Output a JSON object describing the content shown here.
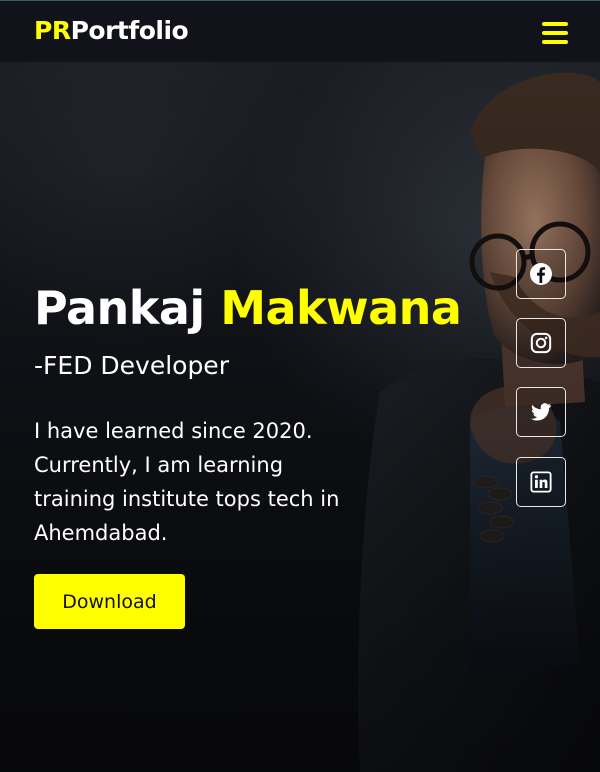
{
  "header": {
    "brand_accent": "PR",
    "brand_rest": "Portfolio",
    "menu_icon": "hamburger-icon"
  },
  "hero": {
    "first_name": "Pankaj",
    "last_name": "Makwana",
    "role": "-FED Developer",
    "bio": "I have learned since 2020. Currently, I am learning training institute tops tech in Ahemdabad.",
    "button_label": "Download"
  },
  "social": [
    {
      "icon": "facebook-icon"
    },
    {
      "icon": "instagram-icon"
    },
    {
      "icon": "twitter-icon"
    },
    {
      "icon": "linkedin-icon"
    }
  ],
  "colors": {
    "accent": "#ffff00",
    "header_bg": "#12121a",
    "background": "#0b0d12",
    "text": "#ffffff"
  }
}
